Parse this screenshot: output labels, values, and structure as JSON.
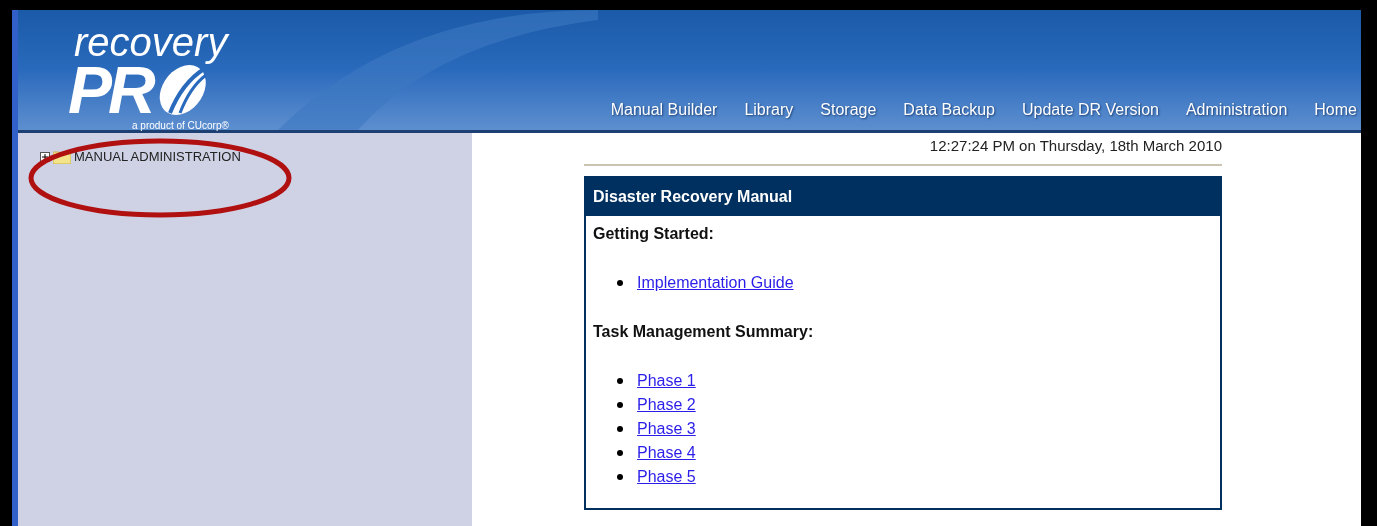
{
  "logo": {
    "wordmark": "recovery",
    "name": "PR",
    "tagline": "a product of CUcorp®"
  },
  "nav": [
    "Manual Builder",
    "Library",
    "Storage",
    "Data Backup",
    "Update DR Version",
    "Administration",
    "Home"
  ],
  "sidebar": {
    "items": [
      {
        "label": "MANUAL ADMINISTRATION",
        "expanded": false
      }
    ]
  },
  "timestamp": "12:27:24 PM on Thursday, 18th March 2010",
  "panel": {
    "title": "Disaster Recovery Manual",
    "sections": [
      {
        "heading": "Getting Started:",
        "links": [
          "Implementation Guide"
        ]
      },
      {
        "heading": "Task Management Summary:",
        "links": [
          "Phase 1",
          "Phase 2",
          "Phase 3",
          "Phase 4",
          "Phase 5"
        ]
      }
    ]
  }
}
